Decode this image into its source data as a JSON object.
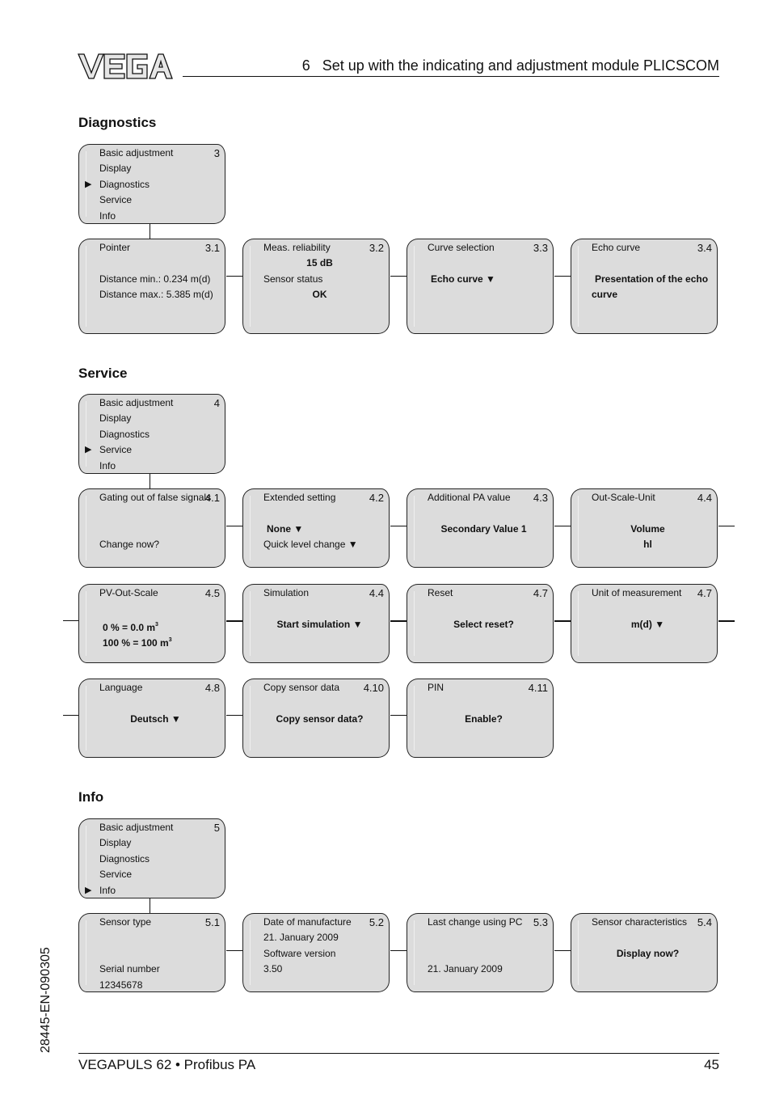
{
  "header": {
    "logo": "VEGA",
    "title": "6   Set up with the indicating and adjustment module PLICSCOM"
  },
  "sections": {
    "diagnostics": {
      "title": "Diagnostics",
      "menu": {
        "number": "3",
        "items": [
          "Basic adjustment",
          "Display",
          "Diagnostics",
          "Service",
          "Info"
        ],
        "selected_index": 2
      },
      "nodes": [
        {
          "title": "Pointer",
          "number": "3.1",
          "lines": [
            "",
            "Distance min.: 0.234 m(d)",
            "Distance max.: 5.385 m(d)"
          ]
        },
        {
          "title": "Meas. reliability",
          "number": "3.2",
          "value1": "15 dB",
          "label2": "Sensor status",
          "value2": "OK"
        },
        {
          "title": "Curve selection",
          "number": "3.3",
          "value": "Echo curve",
          "dropdown": true
        },
        {
          "title": "Echo curve",
          "number": "3.4",
          "value_line1": "Presentation of the echo",
          "value_line2": "curve"
        }
      ]
    },
    "service": {
      "title": "Service",
      "menu": {
        "number": "4",
        "items": [
          "Basic adjustment",
          "Display",
          "Diagnostics",
          "Service",
          "Info"
        ],
        "selected_index": 3
      },
      "row1": [
        {
          "title": "Gating out of false signals",
          "number": "4.1",
          "text": "Change now?"
        },
        {
          "title": "Extended setting",
          "number": "4.2",
          "value": "None",
          "line2": "Quick level change"
        },
        {
          "title": "Additional PA value",
          "number": "4.3",
          "value": "Secondary Value 1"
        },
        {
          "title": "Out-Scale-Unit",
          "number": "4.4",
          "value1": "Volume",
          "value2": "hl"
        }
      ],
      "row2": [
        {
          "title": "PV-Out-Scale",
          "number": "4.5",
          "line1": "0 % = 0.0 m",
          "line2": "100 % = 100 m",
          "unit_sup": "3"
        },
        {
          "title": "Simulation",
          "number": "4.4",
          "value": "Start simulation"
        },
        {
          "title": "Reset",
          "number": "4.7",
          "value": "Select reset?"
        },
        {
          "title": "Unit of measurement",
          "number": "4.7",
          "value": "m(d)"
        }
      ],
      "row3": [
        {
          "title": "Language",
          "number": "4.8",
          "value": "Deutsch"
        },
        {
          "title": "Copy sensor data",
          "number": "4.10",
          "value": "Copy sensor data?"
        },
        {
          "title": "PIN",
          "number": "4.11",
          "value": "Enable?"
        }
      ]
    },
    "info": {
      "title": "Info",
      "menu": {
        "number": "5",
        "items": [
          "Basic adjustment",
          "Display",
          "Diagnostics",
          "Service",
          "Info"
        ],
        "selected_index": 4
      },
      "nodes": [
        {
          "title": "Sensor type",
          "number": "5.1",
          "label2": "Serial number",
          "value2": "12345678"
        },
        {
          "title": "Date of manufacture",
          "number": "5.2",
          "value1": "21. January 2009",
          "label2": "Software version",
          "value2": "3.50"
        },
        {
          "title": "Last change using PC",
          "number": "5.3",
          "value": "21. January 2009"
        },
        {
          "title": "Sensor characteristics",
          "number": "5.4",
          "value": "Display now?"
        }
      ]
    }
  },
  "icons": {
    "selected_marker": "▶",
    "dropdown": "▼"
  },
  "footer": {
    "product": "VEGAPULS 62 • Profibus PA",
    "page": "45",
    "doc_id": "28445-EN-090305"
  }
}
